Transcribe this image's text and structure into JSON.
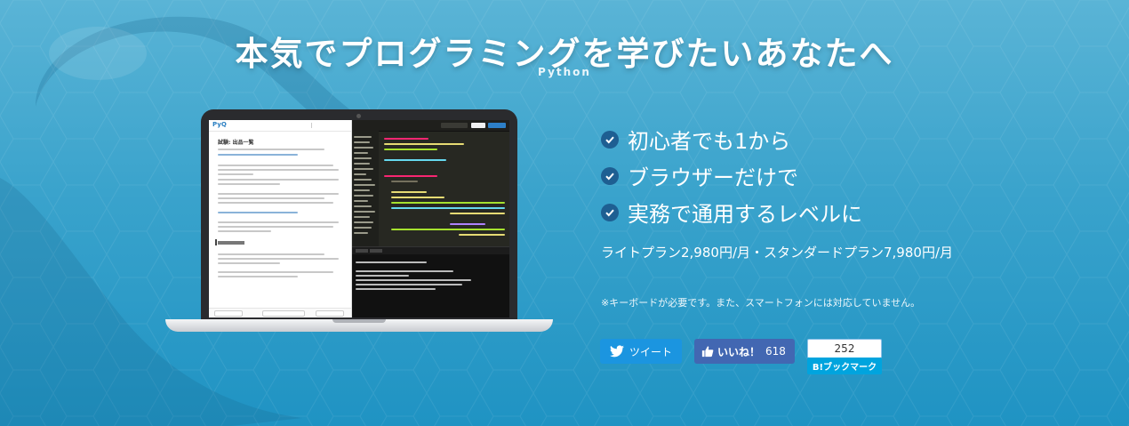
{
  "hero": {
    "title": "本気でプログラミングを学びたいあなたへ",
    "subtitle": "Python"
  },
  "features": [
    {
      "label": "初心者でも1から",
      "icon": "check-circle-icon"
    },
    {
      "label": "ブラウザーだけで",
      "icon": "check-circle-icon"
    },
    {
      "label": "実務で通用するレベルに",
      "icon": "check-circle-icon"
    }
  ],
  "pricing": {
    "text": "ライトプラン2,980円/月・スタンダードプラン7,980円/月"
  },
  "notice": {
    "text": "※キーボードが必要です。また、スマートフォンには対応していません。"
  },
  "social": {
    "tweet_label": "ツイート",
    "like_label": "いいね！",
    "like_count": "618",
    "hatena_count": "252",
    "hatena_label": "B!ブックマーク"
  },
  "laptop_screen": {
    "doc_logo": "PyQ",
    "doc_title": "試験: 出品一覧"
  },
  "colors": {
    "background_top": "#5ab4d6",
    "background_bottom": "#1f93c3",
    "check_icon": "#1e5f92",
    "twitter": "#1b95e0",
    "facebook": "#4267b2",
    "hatena": "#00a4de"
  }
}
